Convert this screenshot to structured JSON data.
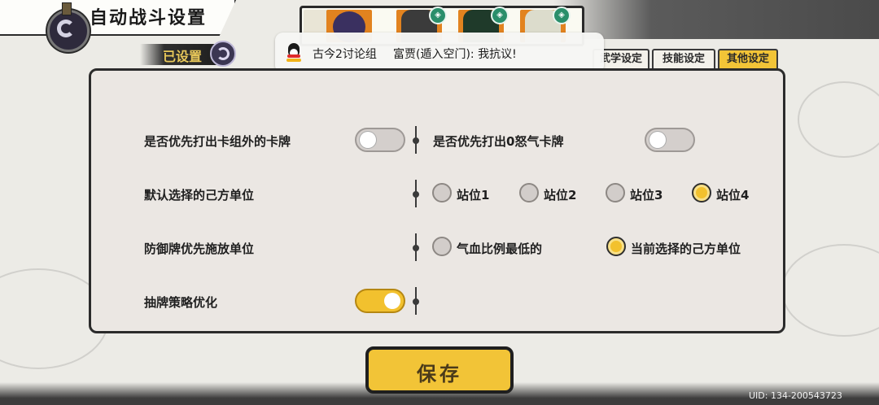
{
  "header": {
    "title": "自动战斗设置"
  },
  "configured_tag": {
    "label": "已设置"
  },
  "notification": {
    "group": "古今2讨论组",
    "message": "富贾(遁入空门): 我抗议!"
  },
  "tabs": [
    {
      "label": "武学设定",
      "active": false
    },
    {
      "label": "技能设定",
      "active": false
    },
    {
      "label": "其他设定",
      "active": true
    }
  ],
  "settings": {
    "row1": {
      "left_label": "是否优先打出卡组外的卡牌",
      "left_toggle": false,
      "right_label": "是否优先打出0怒气卡牌",
      "right_toggle": false
    },
    "row2": {
      "label": "默认选择的己方单位",
      "options": [
        "站位1",
        "站位2",
        "站位3",
        "站位4"
      ],
      "selected": "站位4"
    },
    "row3": {
      "label": "防御牌优先施放单位",
      "options": [
        "气血比例最低的",
        "当前选择的己方单位"
      ],
      "selected": "当前选择的己方单位"
    },
    "row4": {
      "label": "抽牌策略优化",
      "toggle": true
    }
  },
  "save_button": {
    "label": "保存"
  },
  "uid": "UID:  134-200543723",
  "colors": {
    "accent": "#f2c437",
    "panel": "#ebe7e3",
    "border": "#2b2b2b"
  }
}
